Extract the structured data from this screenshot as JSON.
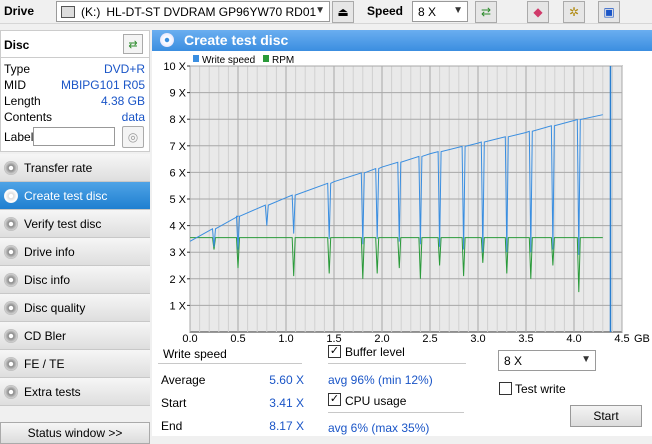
{
  "toolbar": {
    "drive_label": "Drive",
    "drive_letter": "(K:)",
    "drive_name": "HL-DT-ST DVDRAM GP96YW70 RD01",
    "speed_label": "Speed",
    "speed_value": "8 X"
  },
  "disc": {
    "title": "Disc",
    "rows": [
      {
        "key": "Type",
        "value": "DVD+R"
      },
      {
        "key": "MID",
        "value": "MBIPG101 R05"
      },
      {
        "key": "Length",
        "value": "4.38 GB"
      },
      {
        "key": "Contents",
        "value": "data"
      }
    ],
    "label_key": "Label",
    "label_value": ""
  },
  "nav": [
    {
      "label": "Transfer rate",
      "active": false
    },
    {
      "label": "Create test disc",
      "active": true
    },
    {
      "label": "Verify test disc",
      "active": false
    },
    {
      "label": "Drive info",
      "active": false
    },
    {
      "label": "Disc info",
      "active": false
    },
    {
      "label": "Disc quality",
      "active": false
    },
    {
      "label": "CD Bler",
      "active": false
    },
    {
      "label": "FE / TE",
      "active": false
    },
    {
      "label": "Extra tests",
      "active": false
    }
  ],
  "status_window": "Status window >>",
  "panel": {
    "title": "Create test disc"
  },
  "chart_data": {
    "type": "line",
    "xlabel_unit": "GB",
    "xlim": [
      0,
      4.5
    ],
    "x_ticks": [
      "0.0",
      "0.5",
      "1.0",
      "1.5",
      "2.0",
      "2.5",
      "3.0",
      "3.5",
      "4.0",
      "4.5"
    ],
    "ylim": [
      0,
      10
    ],
    "y_ticks": [
      "1 X",
      "2 X",
      "3 X",
      "4 X",
      "5 X",
      "6 X",
      "7 X",
      "8 X",
      "9 X",
      "10 X"
    ],
    "grid": true,
    "legend": [
      "Write speed",
      "RPM"
    ],
    "colors": {
      "write_speed": "#3a8ee0",
      "rpm": "#2a9a3a",
      "marker": "#2a7fd0"
    },
    "series": [
      {
        "name": "Write speed",
        "x": [
          0.0,
          0.5,
          1.0,
          1.5,
          2.0,
          2.5,
          3.0,
          3.5,
          4.0,
          4.3
        ],
        "values": [
          3.41,
          4.35,
          5.05,
          5.65,
          6.2,
          6.7,
          7.1,
          7.5,
          7.95,
          8.17
        ]
      },
      {
        "name": "RPM",
        "x": [
          0.0,
          4.3
        ],
        "values": [
          3.55,
          3.55
        ]
      }
    ],
    "write_speed_dips": [
      [
        0.25,
        3.2
      ],
      [
        0.5,
        3.1
      ],
      [
        0.8,
        4.0
      ],
      [
        1.08,
        3.7
      ],
      [
        1.45,
        3.5
      ],
      [
        1.8,
        3.3
      ],
      [
        1.95,
        3.5
      ],
      [
        2.18,
        3.4
      ],
      [
        2.4,
        3.3
      ],
      [
        2.6,
        3.2
      ],
      [
        2.85,
        3.1
      ],
      [
        3.05,
        3.0
      ],
      [
        3.3,
        3.0
      ],
      [
        3.55,
        3.0
      ],
      [
        3.78,
        3.1
      ],
      [
        4.05,
        2.9
      ]
    ],
    "rpm_dips": [
      [
        0.25,
        3.1
      ],
      [
        0.5,
        2.4
      ],
      [
        1.08,
        2.1
      ],
      [
        1.45,
        2.2
      ],
      [
        1.8,
        2.0
      ],
      [
        1.95,
        2.2
      ],
      [
        2.18,
        2.4
      ],
      [
        2.4,
        2.0
      ],
      [
        2.6,
        2.5
      ],
      [
        2.85,
        2.1
      ],
      [
        3.05,
        2.6
      ],
      [
        3.3,
        2.2
      ],
      [
        3.55,
        2.0
      ],
      [
        3.78,
        2.5
      ],
      [
        4.05,
        1.5
      ]
    ],
    "end_marker_x": 4.38
  },
  "stats": {
    "write_speed_header": "Write speed",
    "average_label": "Average",
    "average_value": "5.60 X",
    "start_label": "Start",
    "start_value": "3.41 X",
    "end_label": "End",
    "end_value": "8.17 X",
    "buffer_label": "Buffer level",
    "buffer_checked": true,
    "buffer_value": "avg 96% (min 12%)",
    "cpu_label": "CPU usage",
    "cpu_checked": true,
    "cpu_value": "avg 6% (max 35%)",
    "write_speed_select": "8 X",
    "test_write_label": "Test write",
    "test_write_checked": false,
    "start_button": "Start"
  }
}
